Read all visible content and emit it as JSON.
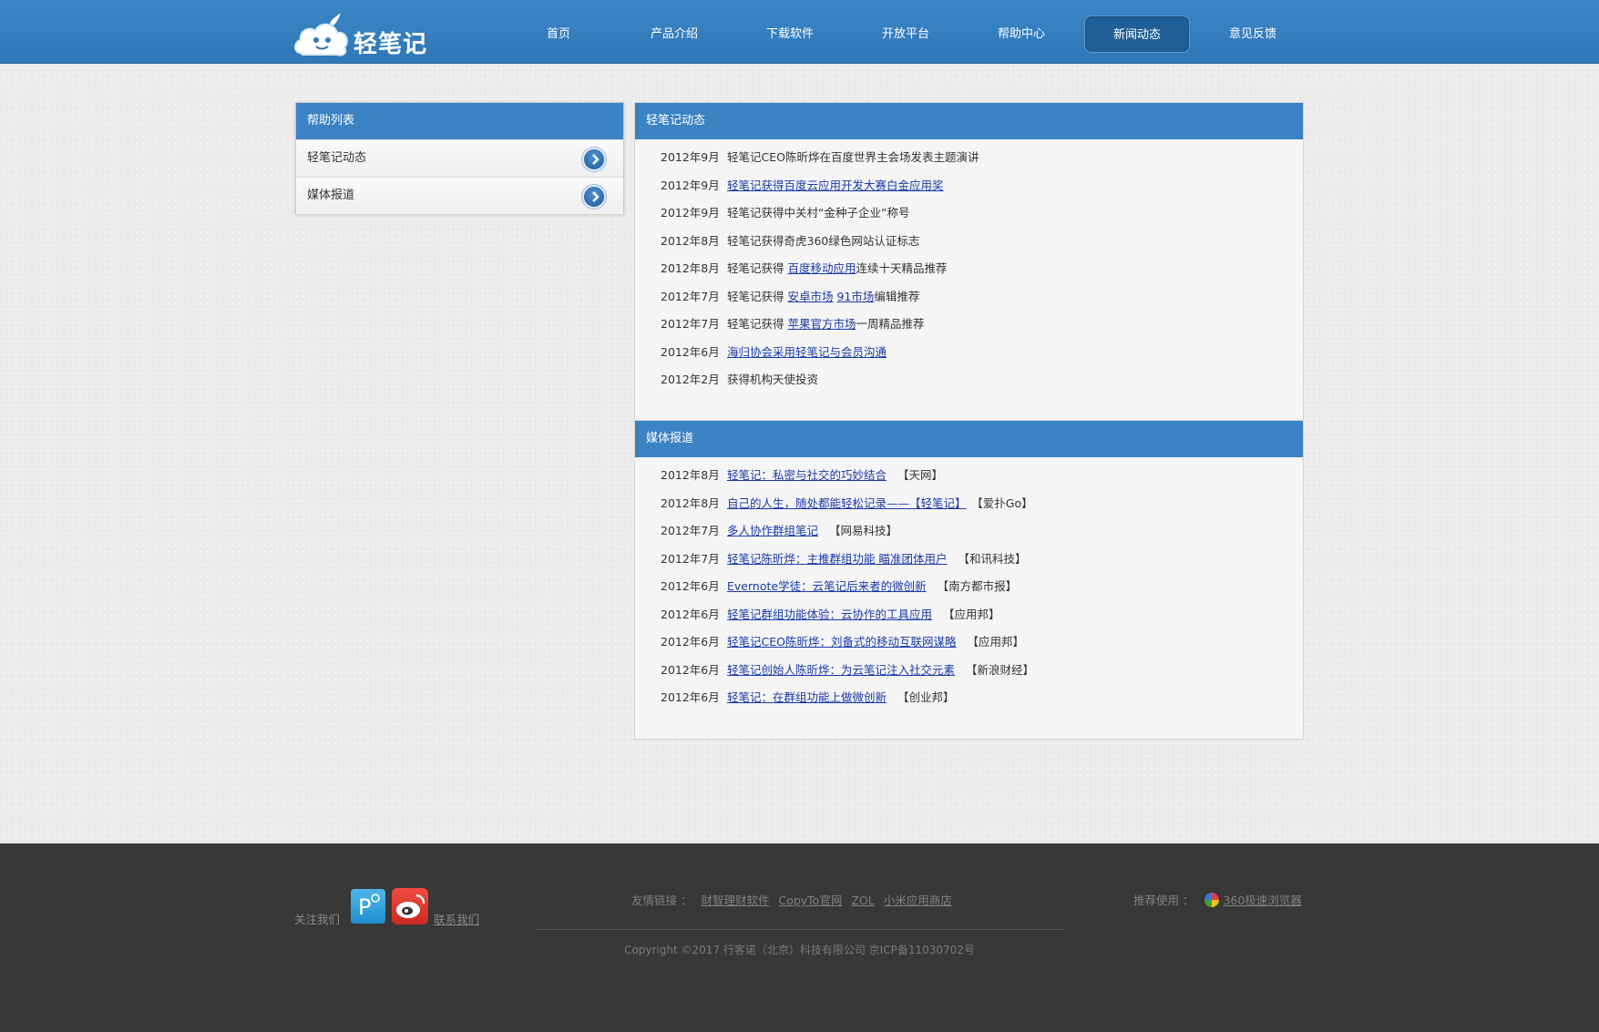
{
  "header": {
    "logo_text": "轻笔记",
    "nav": [
      "首页",
      "产品介绍",
      "下载软件",
      "开放平台",
      "帮助中心",
      "新闻动态",
      "意见反馈"
    ],
    "active_index": 5,
    "colors": {
      "bar": "#2f7ab9",
      "active": "#1f5f96"
    }
  },
  "sidebar": {
    "title": "帮助列表",
    "items": [
      {
        "label": "轻笔记动态"
      },
      {
        "label": "媒体报道"
      }
    ]
  },
  "news_section": {
    "title": "轻笔记动态",
    "rows": [
      {
        "date": "2012年9月",
        "parts": [
          {
            "t": "轻笔记CEO陈昕烨在百度世界主会场发表主题演讲",
            "link": false
          }
        ]
      },
      {
        "date": "2012年9月",
        "parts": [
          {
            "t": "轻笔记获得百度云应用开发大赛白金应用奖",
            "link": true
          }
        ]
      },
      {
        "date": "2012年9月",
        "parts": [
          {
            "t": "轻笔记获得中关村“金种子企业”称号",
            "link": false
          }
        ]
      },
      {
        "date": "2012年8月",
        "parts": [
          {
            "t": "轻笔记获得奇虎360绿色网站认证标志",
            "link": false
          }
        ]
      },
      {
        "date": "2012年8月",
        "parts": [
          {
            "t": "轻笔记获得 ",
            "link": false
          },
          {
            "t": "百度移动应用",
            "link": true
          },
          {
            "t": "连续十天精品推荐",
            "link": false
          }
        ]
      },
      {
        "date": "2012年7月",
        "parts": [
          {
            "t": "轻笔记获得 ",
            "link": false
          },
          {
            "t": "安卓市场",
            "link": true
          },
          {
            "t": " ",
            "link": false
          },
          {
            "t": "91市场",
            "link": true
          },
          {
            "t": "编辑推荐",
            "link": false
          }
        ]
      },
      {
        "date": "2012年7月",
        "parts": [
          {
            "t": "轻笔记获得 ",
            "link": false
          },
          {
            "t": "苹果官方市场",
            "link": true
          },
          {
            "t": "一周精品推荐",
            "link": false
          }
        ]
      },
      {
        "date": "2012年6月",
        "parts": [
          {
            "t": "海归协会采用轻笔记与会员沟通",
            "link": true
          }
        ]
      },
      {
        "date": "2012年2月",
        "parts": [
          {
            "t": "获得机构天使投资",
            "link": false
          }
        ]
      }
    ]
  },
  "media_section": {
    "title": "媒体报道",
    "rows": [
      {
        "date": "2012年8月",
        "title": "轻笔记：私密与社交的巧妙结合",
        "source": "【天网】"
      },
      {
        "date": "2012年8月",
        "title": "自己的人生，随处都能轻松记录——【轻笔记】",
        "source": "【爱扑Go】"
      },
      {
        "date": "2012年7月",
        "title": "多人协作群组笔记",
        "source": "【网易科技】"
      },
      {
        "date": "2012年7月",
        "title": "轻笔记陈昕烨：主推群组功能 瞄准团体用户",
        "source": "【和讯科技】"
      },
      {
        "date": "2012年6月",
        "title": "Evernote学徒：云笔记后来者的微创新",
        "source": "【南方都市报】"
      },
      {
        "date": "2012年6月",
        "title": "轻笔记群组功能体验：云协作的工具应用",
        "source": "【应用邦】"
      },
      {
        "date": "2012年6月",
        "title": "轻笔记CEO陈昕烨：刘备式的移动互联网谋略",
        "source": "【应用邦】"
      },
      {
        "date": "2012年6月",
        "title": "轻笔记创始人陈昕烨：为云笔记注入社交元素",
        "source": "【新浪财经】"
      },
      {
        "date": "2012年6月",
        "title": "轻笔记：在群组功能上做微创新",
        "source": "【创业邦】"
      }
    ]
  },
  "footer": {
    "follow_label": "关注我们",
    "contact_label": "联系我们",
    "friends_label": "友情链接 ：",
    "friend_links": [
      "财智理财软件",
      "CopyTo官网",
      "ZOL",
      "小米应用商店"
    ],
    "recommend_label": "推荐使用 ：",
    "recommend_link": "360极速浏览器",
    "copyright": "Copyright ©2017 行客诺（北京）科技有限公司 京ICP备11030702号"
  }
}
